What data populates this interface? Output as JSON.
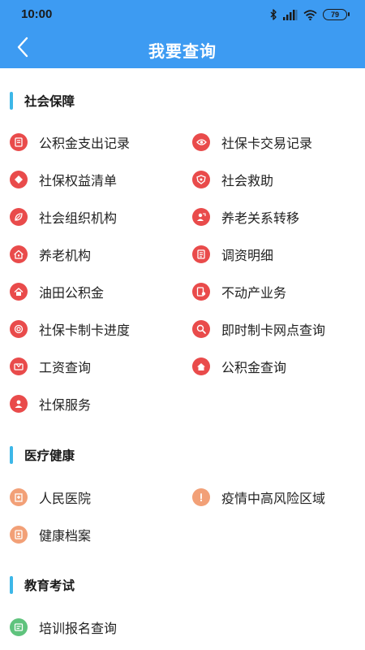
{
  "status_bar": {
    "time": "10:00",
    "battery": "79",
    "icons": [
      "bluetooth-icon",
      "signal-icon",
      "wifi-icon",
      "battery-icon"
    ]
  },
  "header": {
    "title": "我要查询",
    "back_icon": "chevron-left-icon"
  },
  "colors": {
    "header_bg": "#3d9bf2",
    "section_accent": "#3db7e8",
    "social_icon": "#e94b4b",
    "medical_icon": "#f2a077",
    "education_icon": "#5fc37d"
  },
  "sections": [
    {
      "title": "社会保障",
      "items": [
        {
          "label": "公积金支出记录",
          "icon": "document-icon"
        },
        {
          "label": "社保卡交易记录",
          "icon": "eye-icon"
        },
        {
          "label": "社保权益清单",
          "icon": "diamond-icon"
        },
        {
          "label": "社会救助",
          "icon": "shield-icon"
        },
        {
          "label": "社会组织机构",
          "icon": "leaf-icon"
        },
        {
          "label": "养老关系转移",
          "icon": "person-transfer-icon"
        },
        {
          "label": "养老机构",
          "icon": "home-icon"
        },
        {
          "label": "调资明细",
          "icon": "list-icon"
        },
        {
          "label": "油田公积金",
          "icon": "home-fund-icon"
        },
        {
          "label": "不动产业务",
          "icon": "property-document-icon"
        },
        {
          "label": "社保卡制卡进度",
          "icon": "progress-icon"
        },
        {
          "label": "即时制卡网点查询",
          "icon": "search-icon"
        },
        {
          "label": "工资查询",
          "icon": "wallet-icon"
        },
        {
          "label": "公积金查询",
          "icon": "house-fund-icon"
        },
        {
          "label": "社保服务",
          "icon": "user-icon"
        }
      ]
    },
    {
      "title": "医疗健康",
      "items": [
        {
          "label": "人民医院",
          "icon": "hospital-icon"
        },
        {
          "label": "疫情中高风险区域",
          "icon": "alert-icon"
        },
        {
          "label": "健康档案",
          "icon": "health-record-icon"
        }
      ]
    },
    {
      "title": "教育考试",
      "items": [
        {
          "label": "培训报名查询",
          "icon": "training-icon"
        }
      ]
    }
  ]
}
